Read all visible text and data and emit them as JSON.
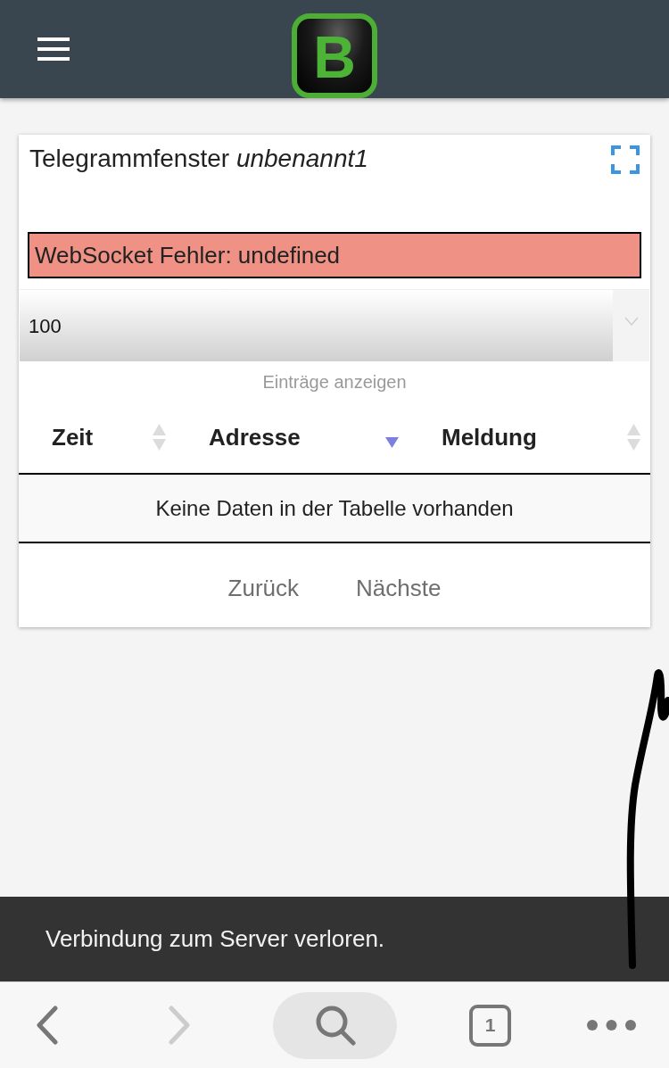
{
  "header": {
    "logo_letter": "B"
  },
  "panel": {
    "title": "Telegrammfenster *unbenannt1*",
    "error": "WebSocket Fehler: undefined",
    "page_length": {
      "value": "100",
      "caption": "Einträge anzeigen"
    },
    "table": {
      "columns": [
        {
          "label": "Zeit",
          "sorted": false
        },
        {
          "label": "Adresse",
          "sorted": true,
          "descending": true
        },
        {
          "label": "Meldung",
          "sorted": false
        }
      ],
      "empty_message": "Keine Daten in der Tabelle vorhanden"
    },
    "pagination": [
      {
        "label": "Zurück",
        "disabled": true
      },
      {
        "label": "Nächste",
        "disabled": true
      }
    ]
  },
  "toast": "Verbindung zum Server verloren.",
  "browser_toolbar": {
    "back": {
      "disabled": false
    },
    "forward": {
      "disabled": true
    },
    "tab_count": "1"
  }
}
